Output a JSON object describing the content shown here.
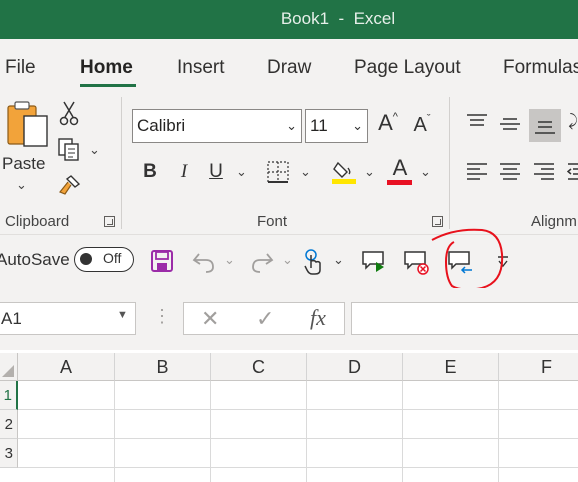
{
  "window": {
    "title": "Book1  -  Excel"
  },
  "tabs": [
    "File",
    "Home",
    "Insert",
    "Draw",
    "Page Layout",
    "Formulas"
  ],
  "active_tab": "Home",
  "clipboard": {
    "paste_label": "Paste",
    "group_label": "Clipboard"
  },
  "font": {
    "family": "Calibri",
    "size": "11",
    "group_label": "Font",
    "bold": "B",
    "italic": "I",
    "underline": "U",
    "color_letter": "A"
  },
  "alignment": {
    "group_label": "Alignm"
  },
  "qat": {
    "autosave_label": "AutoSave",
    "autosave_state": "Off"
  },
  "formula_bar": {
    "name_box": "A1",
    "fx_label": "fx",
    "cancel": "✕",
    "enter": "✓",
    "dots": "⋮"
  },
  "grid": {
    "columns": [
      "A",
      "B",
      "C",
      "D",
      "E",
      "F"
    ],
    "rows": [
      "1",
      "2",
      "3"
    ]
  },
  "colors": {
    "brand": "#217346",
    "annotation": "#e8111c",
    "font_color": "#e81123",
    "highlight": "#ffe600"
  }
}
